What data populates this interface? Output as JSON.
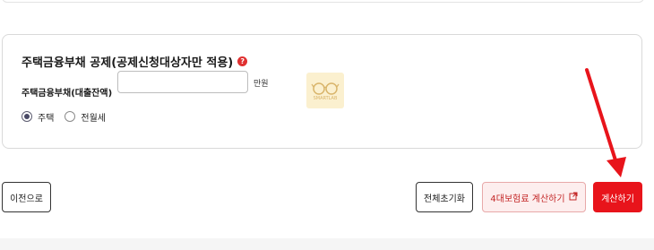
{
  "section": {
    "title": "주택금융부채 공제(공제신청대상자만 적용)",
    "help_icon_glyph": "?",
    "field_label": "주택금융부채(대출잔액)",
    "radio_options": [
      {
        "label": "주택",
        "checked": true
      },
      {
        "label": "전월세",
        "checked": false
      }
    ],
    "amount_value": "",
    "unit": "만원"
  },
  "watermark": {
    "text": "SMARTLAB",
    "icon": "glasses-icon"
  },
  "buttons": {
    "prev": "이전으로",
    "reset": "전체초기화",
    "insurance": "4대보험료 계산하기",
    "insurance_icon": "external-link-icon",
    "calc": "계산하기"
  },
  "colors": {
    "accent_red": "#e8141b",
    "insurance_text": "#c42828",
    "insurance_bg": "#fdeeee",
    "annotation_arrow": "#e8141b"
  },
  "annotation": {
    "icon": "red-arrow-icon"
  }
}
